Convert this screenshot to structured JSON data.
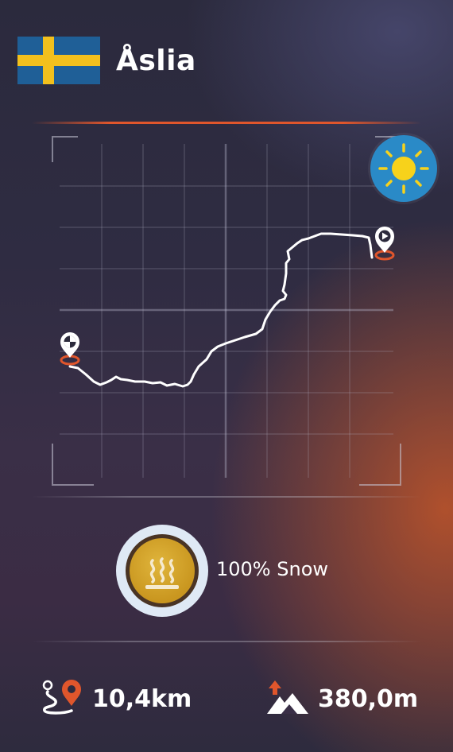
{
  "header": {
    "country_flag": "sweden-flag-icon",
    "title": "Åslia"
  },
  "weather": {
    "icon": "sun-icon"
  },
  "map": {
    "start_marker": "play-pin-icon",
    "finish_marker": "checkered-pin-icon"
  },
  "snow": {
    "icon": "heat-waves-icon",
    "label": "100% Snow"
  },
  "stats": {
    "distance": "10,4km",
    "distance_icon": "route-pin-icon",
    "elevation": "380,0m",
    "elevation_icon": "mountain-up-arrow-icon"
  },
  "colors": {
    "accent_orange": "#e0562c",
    "flag_blue": "#1f5f97",
    "flag_yellow": "#f2c01d",
    "sun_bg": "#2a8ac7",
    "snow_gold": "#d4a52a"
  }
}
